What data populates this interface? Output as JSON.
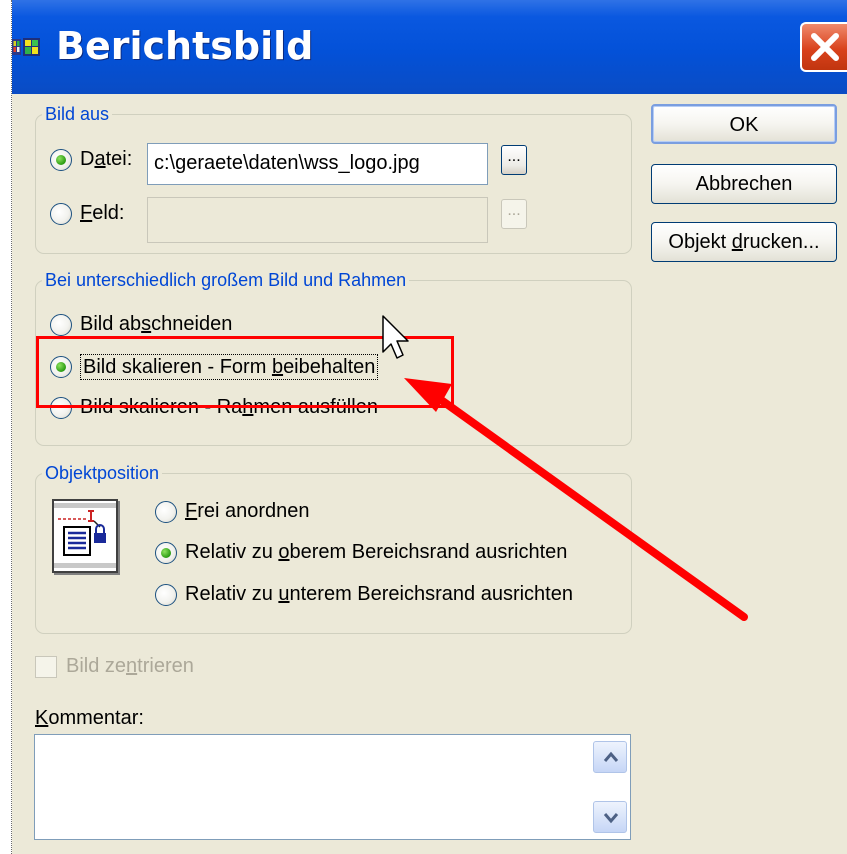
{
  "window": {
    "title": "Berichtsbild",
    "app_icon": "report-image-app-icon",
    "close_icon": "close-x-icon"
  },
  "buttons": {
    "ok": "OK",
    "cancel": "Abbrechen",
    "print_object_pre": "Objekt ",
    "print_object_key": "d",
    "print_object_post": "rucken..."
  },
  "image_source": {
    "legend": "Bild aus",
    "file_option": {
      "pre": "D",
      "key": "a",
      "post": "tei:",
      "checked": true
    },
    "file_path": "c:\\geraete\\daten\\wss_logo.jpg",
    "field_option": {
      "pre": "",
      "key": "F",
      "post": "eld:",
      "checked": false
    },
    "field_value": "",
    "browse_label": "..."
  },
  "size_mismatch": {
    "legend": "Bei unterschiedlich großem Bild und Rahmen",
    "options": [
      {
        "pre": "Bild ab",
        "key": "s",
        "post": "chneiden",
        "checked": false
      },
      {
        "pre": "Bild skalieren - Form ",
        "key": "b",
        "post": "eibehalten",
        "checked": true
      },
      {
        "pre": "Bild skalieren - Ra",
        "key": "h",
        "post": "men ausfüllen",
        "checked": false
      }
    ]
  },
  "object_position": {
    "legend": "Objektposition",
    "icon": "anchor-position-icon",
    "options": [
      {
        "pre": "",
        "key": "F",
        "post": "rei anordnen",
        "checked": false
      },
      {
        "pre": "Relativ zu ",
        "key": "o",
        "post": "berem Bereichsrand ausrichten",
        "checked": true
      },
      {
        "pre": "Relativ zu ",
        "key": "u",
        "post": "nterem Bereichsrand ausrichten",
        "checked": false
      }
    ]
  },
  "center_image": {
    "pre": "Bild ze",
    "key": "n",
    "post": "trieren",
    "checked": false,
    "enabled": false
  },
  "comment": {
    "label_pre": "",
    "label_key": "K",
    "label_post": "ommentar:",
    "value": ""
  },
  "annotation": {
    "color": "#ff0000"
  },
  "colors": {
    "titlebar": "#0351d8",
    "legend_text": "#0046d5",
    "dialog_bg": "#ece9d8"
  }
}
